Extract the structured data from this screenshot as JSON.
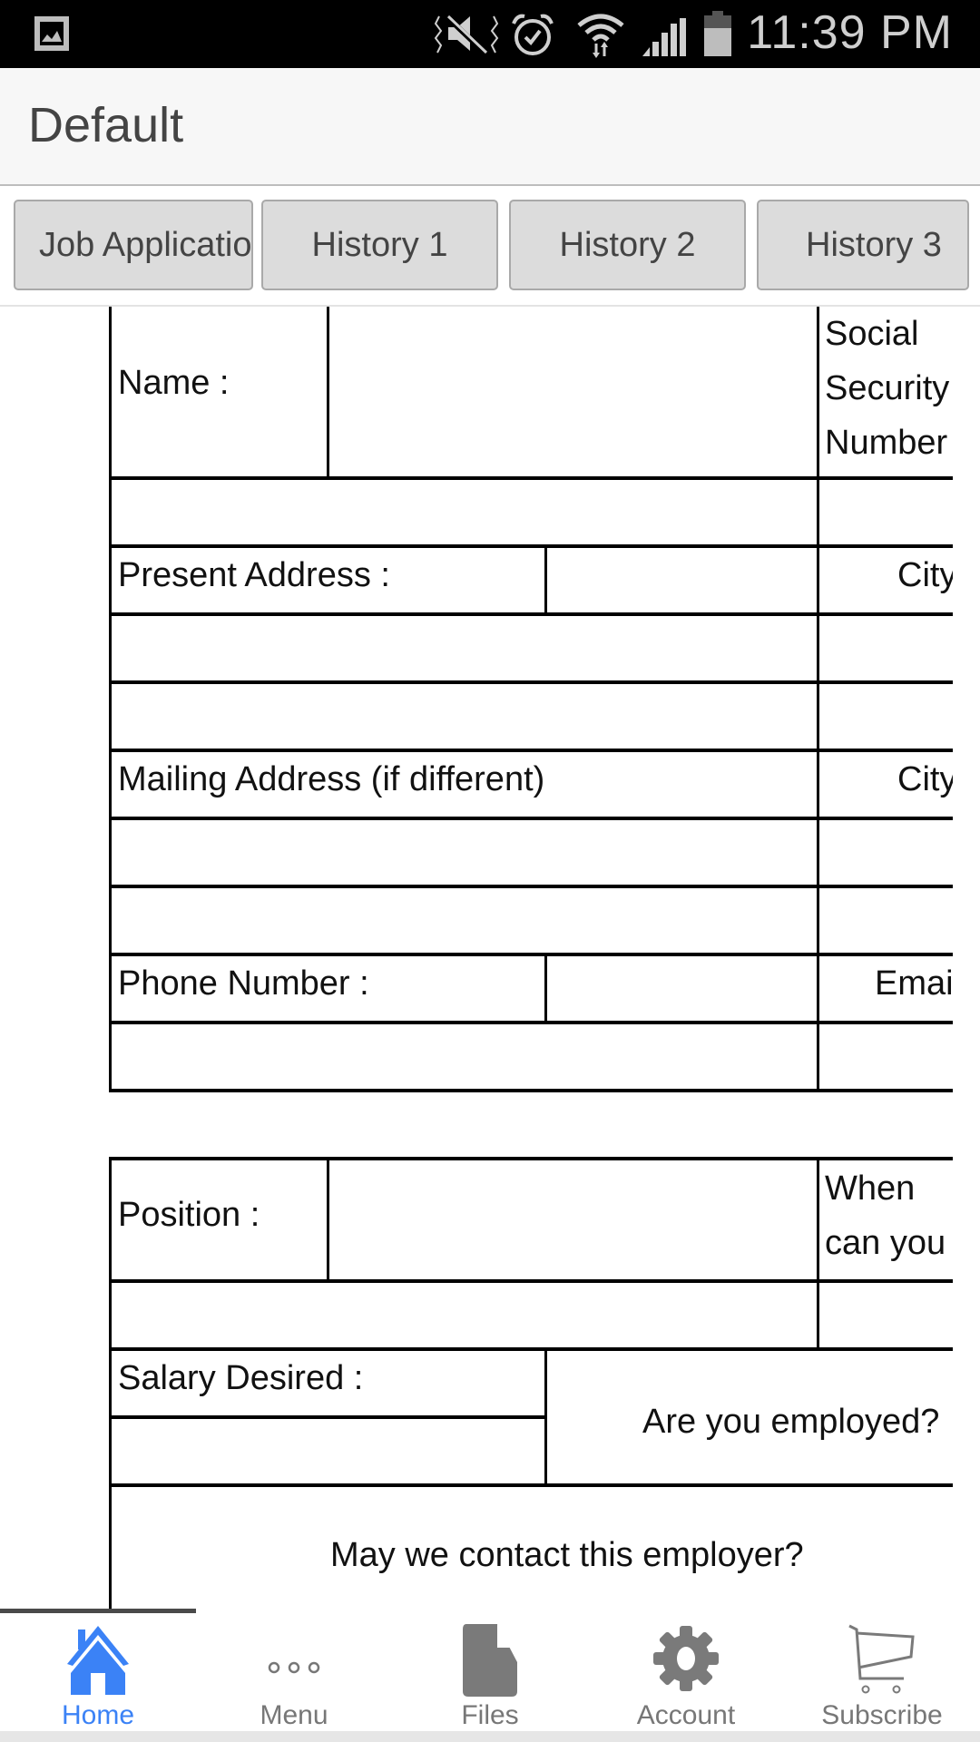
{
  "status_bar": {
    "time": "11:39 PM",
    "icons": [
      "gallery-notification-icon",
      "mute-vibrate-icon",
      "alarm-icon",
      "wifi-icon",
      "signal-icon",
      "battery-icon"
    ]
  },
  "header": {
    "title": "Default"
  },
  "tabs": [
    {
      "label": "Job Application"
    },
    {
      "label": "History 1"
    },
    {
      "label": "History 2"
    },
    {
      "label": "History 3"
    }
  ],
  "form": {
    "section1": {
      "name_label": "Name :",
      "ssn_label": "Social Security Number",
      "present_address_label": "Present Address :",
      "city_label_1": "City",
      "mailing_address_label": "Mailing Address (if different)",
      "city_label_2": "City",
      "phone_label": "Phone Number :",
      "email_label": "Email"
    },
    "section2": {
      "position_label": "Position :",
      "start_label": "When can you start",
      "salary_label": "Salary Desired :",
      "employed_label": "Are you employed?",
      "contact_label": "May we contact this employer?"
    }
  },
  "bottom_nav": {
    "active": "Home",
    "items": [
      {
        "label": "Home",
        "icon": "home-icon"
      },
      {
        "label": "Menu",
        "icon": "more-dots-icon"
      },
      {
        "label": "Files",
        "icon": "file-icon"
      },
      {
        "label": "Account",
        "icon": "gear-icon"
      },
      {
        "label": "Subscribe",
        "icon": "cart-icon"
      }
    ]
  },
  "colors": {
    "accent": "#3b82f6",
    "inactive": "#777777",
    "tab_bg": "#dcdcdc"
  }
}
